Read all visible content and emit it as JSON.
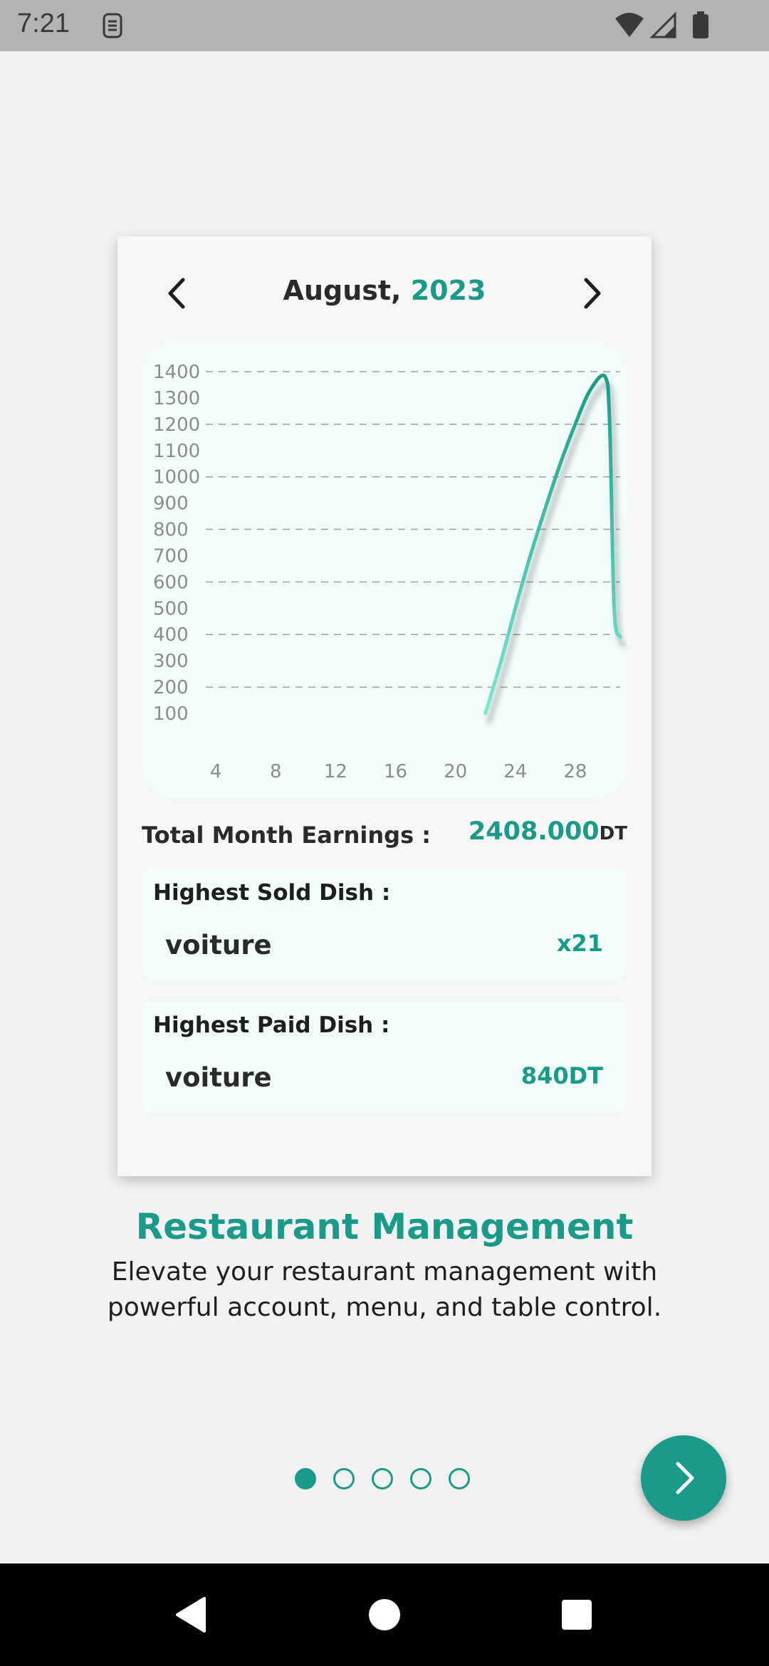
{
  "status_bar": {
    "time": "7:21",
    "icons": [
      "sim-card-icon",
      "wifi-icon",
      "signal-icon",
      "battery-icon"
    ]
  },
  "month_nav": {
    "month": "August,",
    "year": "2023",
    "prev_icon": "chevron-left-icon",
    "next_icon": "chevron-right-icon"
  },
  "chart_data": {
    "type": "line",
    "x_ticks": [
      4,
      8,
      12,
      16,
      20,
      24,
      28
    ],
    "y_ticks": [
      100,
      200,
      300,
      400,
      500,
      600,
      700,
      800,
      900,
      1000,
      1100,
      1200,
      1300,
      1400
    ],
    "xlim": [
      0,
      31
    ],
    "ylim": [
      100,
      1400
    ],
    "grid": "horizontal dashed",
    "series": [
      {
        "color": "#1a9a88",
        "x": [
          22,
          23,
          24,
          25,
          26,
          27,
          28,
          29,
          30,
          30.3,
          30.6,
          31
        ],
        "y": [
          100,
          290,
          500,
          700,
          880,
          1050,
          1200,
          1330,
          1380,
          1200,
          500,
          390
        ]
      }
    ]
  },
  "earnings": {
    "label": "Total Month Earnings :",
    "value": "2408.000",
    "unit": "DT"
  },
  "highest_sold": {
    "title": "Highest Sold Dish :",
    "name": "voiture",
    "value": "x21"
  },
  "highest_paid": {
    "title": "Highest Paid Dish :",
    "name": "voiture",
    "value": "840DT"
  },
  "headline": "Restaurant Management",
  "subtitle": "Elevate your restaurant management with powerful account, menu, and table control.",
  "pager": {
    "count": 5,
    "active": 0
  },
  "fab_icon": "chevron-right-icon",
  "colors": {
    "accent": "#1a9a88",
    "line_light": "#7be8d4"
  }
}
